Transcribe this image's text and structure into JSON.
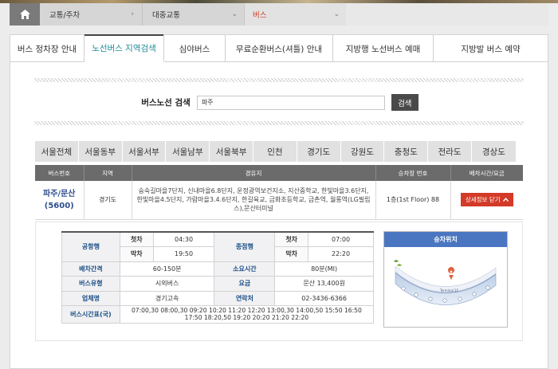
{
  "breadcrumb": {
    "level1": "교통/주차",
    "level2": "대중교통",
    "level3": "버스"
  },
  "tabs": [
    {
      "label": "버스 정차장 안내"
    },
    {
      "label": "노선버스 지역검색"
    },
    {
      "label": "심야버스"
    },
    {
      "label": "무료순환버스(셔틀) 안내"
    },
    {
      "label": "지방행 노선버스 예매"
    },
    {
      "label": "지방발 버스 예약"
    }
  ],
  "search": {
    "label": "버스노선 검색",
    "value": "파주",
    "button": "검색"
  },
  "regions": [
    "서울전체",
    "서울동부",
    "서울서부",
    "서울남부",
    "서울북부",
    "인천",
    "경기도",
    "강원도",
    "충청도",
    "전라도",
    "경상도"
  ],
  "results": {
    "headers": [
      "버스번호",
      "지역",
      "경유지",
      "승차장 번호",
      "배차시간/요금"
    ],
    "row": {
      "bus_name": "파주/문산",
      "bus_number": "(5600)",
      "region": "경기도",
      "stops": "숭숙길마을7단지, 신내마을6.8단지, 운정광역보건지소, 지산중학교, 한빛마을3.6단지, 한빛마을4.5단지, 가람마을3.4.6단지, 한길육교, 금화초등학교, 금촌역, 월롱역(LG필립스),문산터미널",
      "platform": "1층(1st Floor) 88",
      "detail_button": "상세정보 닫기"
    }
  },
  "detail": {
    "airport_label": "공항행",
    "terminal_label": "종점행",
    "first_label": "첫차",
    "last_label": "막차",
    "airport_first": "04:30",
    "airport_last": "19:50",
    "terminal_first": "07:00",
    "terminal_last": "22:20",
    "interval_label": "배차간격",
    "interval": "60-150분",
    "duration_label": "소요시간",
    "duration": "80분(MI)",
    "type_label": "버스유형",
    "type": "시외버스",
    "fare_label": "요금",
    "fare": "문산 13,400원",
    "company_label": "업체명",
    "company": "경기고속",
    "contact_label": "연락처",
    "contact": "02-3436-6366",
    "timetable_label": "버스시간표(국)",
    "timetable": "07:00,30 08:00,30 09:20 10:20 11:20 12:20 13:00,30 14:00,50 15:50 16:50 17:50 18:20,50 19:20 20:20 21:20 22:20",
    "map_title": "승차위치",
    "map_terminal_label": "Terminal 1F"
  },
  "colors": {
    "accent_tab": "#1e8a97",
    "breadcrumb_active": "#d23c2a",
    "detail_button": "#d33a28",
    "map_header": "#4a76c1"
  }
}
